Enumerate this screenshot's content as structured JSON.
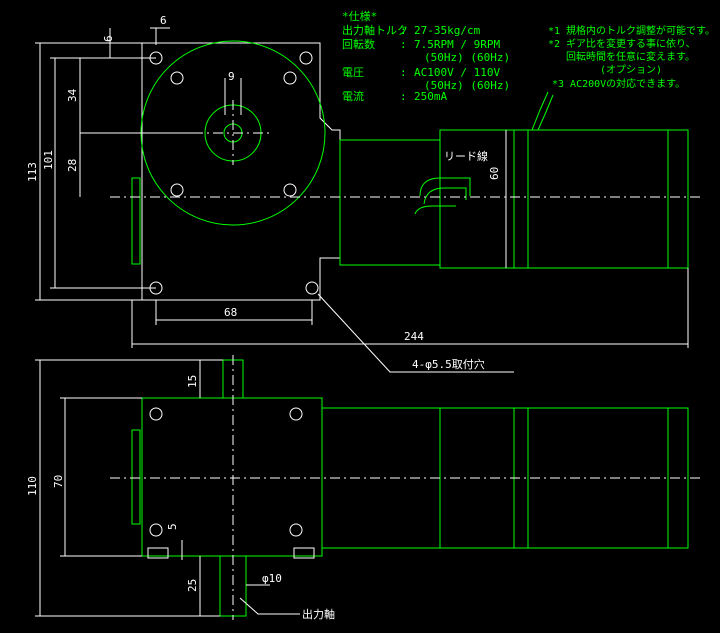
{
  "specs": {
    "heading": "*仕様*",
    "labels": [
      "出力軸トルク",
      "回転数",
      "",
      "電圧",
      "",
      "電流"
    ],
    "colons": [
      ":",
      ":",
      "",
      ":",
      "",
      ":"
    ],
    "values": [
      "27-35kg/cm",
      "7.5RPM / 9RPM",
      "(50Hz) (60Hz)",
      "AC100V / 110V",
      "(50Hz) (60Hz)",
      "250mA"
    ]
  },
  "notes": {
    "lines": [
      "*1 規格内のトルク調整が可能です。",
      "*2 ギア比を変更する事に依り、",
      "回転時間を任意に変えます。",
      "(オプション)",
      "*3 AC200Vの対応できます。"
    ]
  },
  "top_view": {
    "lead_wire_label": "リード線",
    "dims": {
      "d6_top": "6",
      "d6_side": "6",
      "d9": "9",
      "d34": "34",
      "d28": "28",
      "d113": "113",
      "d101": "101",
      "d60": "60",
      "d68": "68",
      "d244": "244"
    },
    "hole_callout": "4-φ5.5取付穴"
  },
  "bottom_view": {
    "dims": {
      "d15": "15",
      "d110": "110",
      "d70": "70",
      "d5": "5",
      "d25": "25",
      "dphi10": "φ10"
    },
    "output_shaft_label": "出力軸"
  }
}
